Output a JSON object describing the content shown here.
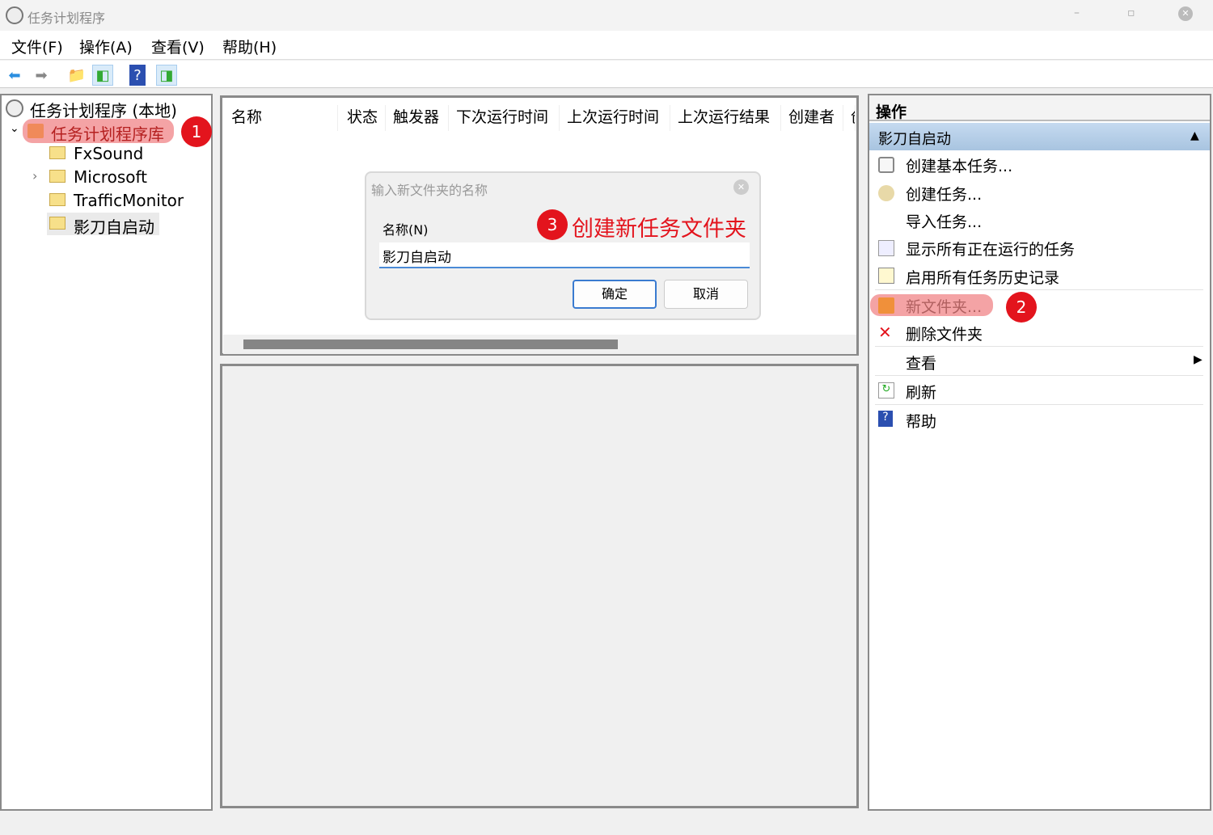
{
  "window": {
    "title": "任务计划程序",
    "minimize": "–",
    "maximize": "▫",
    "close": "✕"
  },
  "menu": [
    "文件(F)",
    "操作(A)",
    "查看(V)",
    "帮助(H)"
  ],
  "tree": {
    "root": "任务计划程序 (本地)",
    "library": "任务计划程序库",
    "folders": [
      "FxSound",
      "Microsoft",
      "TrafficMonitor",
      "影刀自启动"
    ]
  },
  "columns": [
    "名称",
    "状态",
    "触发器",
    "下次运行时间",
    "上次运行时间",
    "上次运行结果",
    "创建者",
    "创"
  ],
  "dialog": {
    "title": "输入新文件夹的名称",
    "label": "名称(N)",
    "value": "影刀自启动",
    "ok": "确定",
    "cancel": "取消"
  },
  "annotations": {
    "step1": "1",
    "step2": "2",
    "step3": "3",
    "step3_text": "创建新任务文件夹",
    "color": "#e3141d"
  },
  "actions": {
    "header": "操作",
    "section": "影刀自启动",
    "items": [
      "创建基本任务...",
      "创建任务...",
      "导入任务...",
      "显示所有正在运行的任务",
      "启用所有任务历史记录",
      "新文件夹...",
      "删除文件夹",
      "查看",
      "刷新",
      "帮助"
    ]
  }
}
